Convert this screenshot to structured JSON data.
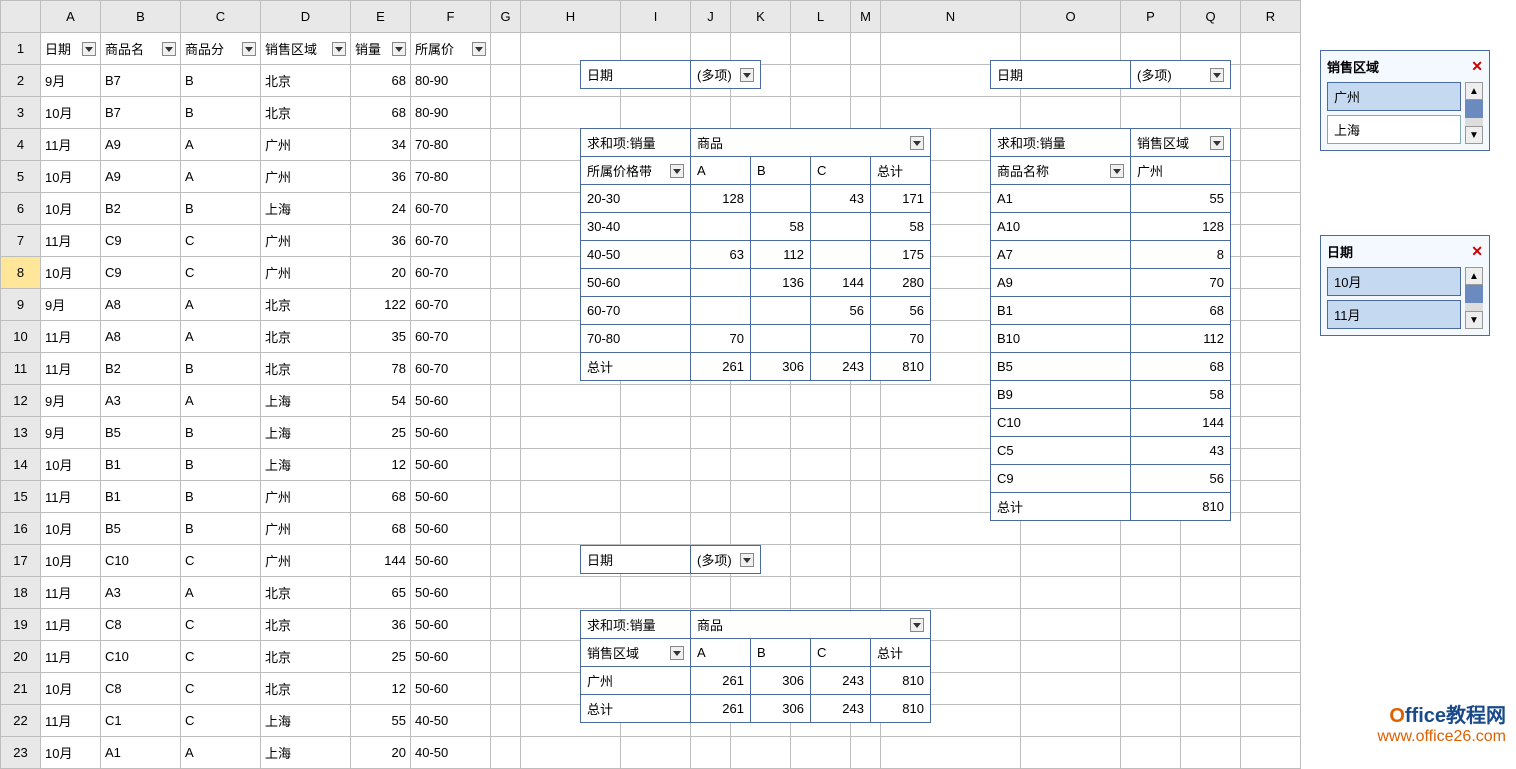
{
  "columns": [
    "",
    "A",
    "B",
    "C",
    "D",
    "E",
    "F",
    "G",
    "H",
    "I",
    "J",
    "K",
    "L",
    "M",
    "N",
    "O",
    "P",
    "Q",
    "R"
  ],
  "headers": [
    "日期",
    "商品名",
    "商品分",
    "销售区域",
    "销量",
    "所属价"
  ],
  "rows": [
    {
      "r": 2,
      "d": [
        "9月",
        "B7",
        "B",
        "北京",
        "68",
        "80-90"
      ]
    },
    {
      "r": 3,
      "d": [
        "10月",
        "B7",
        "B",
        "北京",
        "68",
        "80-90"
      ]
    },
    {
      "r": 4,
      "d": [
        "11月",
        "A9",
        "A",
        "广州",
        "34",
        "70-80"
      ]
    },
    {
      "r": 5,
      "d": [
        "10月",
        "A9",
        "A",
        "广州",
        "36",
        "70-80"
      ]
    },
    {
      "r": 6,
      "d": [
        "10月",
        "B2",
        "B",
        "上海",
        "24",
        "60-70"
      ]
    },
    {
      "r": 7,
      "d": [
        "11月",
        "C9",
        "C",
        "广州",
        "36",
        "60-70"
      ]
    },
    {
      "r": 8,
      "d": [
        "10月",
        "C9",
        "C",
        "广州",
        "20",
        "60-70"
      ],
      "sel": true
    },
    {
      "r": 9,
      "d": [
        "9月",
        "A8",
        "A",
        "北京",
        "122",
        "60-70"
      ]
    },
    {
      "r": 10,
      "d": [
        "11月",
        "A8",
        "A",
        "北京",
        "35",
        "60-70"
      ]
    },
    {
      "r": 11,
      "d": [
        "11月",
        "B2",
        "B",
        "北京",
        "78",
        "60-70"
      ]
    },
    {
      "r": 12,
      "d": [
        "9月",
        "A3",
        "A",
        "上海",
        "54",
        "50-60"
      ]
    },
    {
      "r": 13,
      "d": [
        "9月",
        "B5",
        "B",
        "上海",
        "25",
        "50-60"
      ]
    },
    {
      "r": 14,
      "d": [
        "10月",
        "B1",
        "B",
        "上海",
        "12",
        "50-60"
      ]
    },
    {
      "r": 15,
      "d": [
        "11月",
        "B1",
        "B",
        "广州",
        "68",
        "50-60"
      ]
    },
    {
      "r": 16,
      "d": [
        "10月",
        "B5",
        "B",
        "广州",
        "68",
        "50-60"
      ]
    },
    {
      "r": 17,
      "d": [
        "10月",
        "C10",
        "C",
        "广州",
        "144",
        "50-60"
      ]
    },
    {
      "r": 18,
      "d": [
        "11月",
        "A3",
        "A",
        "北京",
        "65",
        "50-60"
      ]
    },
    {
      "r": 19,
      "d": [
        "11月",
        "C8",
        "C",
        "北京",
        "36",
        "50-60"
      ]
    },
    {
      "r": 20,
      "d": [
        "11月",
        "C10",
        "C",
        "北京",
        "25",
        "50-60"
      ]
    },
    {
      "r": 21,
      "d": [
        "10月",
        "C8",
        "C",
        "北京",
        "12",
        "50-60"
      ]
    },
    {
      "r": 22,
      "d": [
        "11月",
        "C1",
        "C",
        "上海",
        "55",
        "40-50"
      ]
    },
    {
      "r": 23,
      "d": [
        "10月",
        "A1",
        "A",
        "上海",
        "20",
        "40-50"
      ]
    }
  ],
  "pivotFilter1": {
    "label": "日期",
    "value": "(多项)"
  },
  "pivot1": {
    "sumLabel": "求和项:销量",
    "colLabel": "商品",
    "rowLabel": "所属价格带",
    "cols": [
      "A",
      "B",
      "C",
      "总计"
    ],
    "data": [
      {
        "k": "20-30",
        "v": [
          "128",
          "",
          "43",
          "171"
        ]
      },
      {
        "k": "30-40",
        "v": [
          "",
          "58",
          "",
          "58"
        ]
      },
      {
        "k": "40-50",
        "v": [
          "63",
          "112",
          "",
          "175"
        ]
      },
      {
        "k": "50-60",
        "v": [
          "",
          "136",
          "144",
          "280"
        ]
      },
      {
        "k": "60-70",
        "v": [
          "",
          "",
          "56",
          "56"
        ]
      },
      {
        "k": "70-80",
        "v": [
          "70",
          "",
          "",
          "70"
        ]
      },
      {
        "k": "总计",
        "v": [
          "261",
          "306",
          "243",
          "810"
        ]
      }
    ]
  },
  "pivotFilter2": {
    "label": "日期",
    "value": "(多项)"
  },
  "pivot2": {
    "sumLabel": "求和项:销量",
    "colLabel": "销售区域",
    "rowLabel": "商品名称",
    "cols": [
      "广州"
    ],
    "data": [
      {
        "k": "A1",
        "v": [
          "55"
        ]
      },
      {
        "k": "A10",
        "v": [
          "128"
        ]
      },
      {
        "k": "A7",
        "v": [
          "8"
        ]
      },
      {
        "k": "A9",
        "v": [
          "70"
        ]
      },
      {
        "k": "B1",
        "v": [
          "68"
        ]
      },
      {
        "k": "B10",
        "v": [
          "112"
        ]
      },
      {
        "k": "B5",
        "v": [
          "68"
        ]
      },
      {
        "k": "B9",
        "v": [
          "58"
        ]
      },
      {
        "k": "C10",
        "v": [
          "144"
        ]
      },
      {
        "k": "C5",
        "v": [
          "43"
        ]
      },
      {
        "k": "C9",
        "v": [
          "56"
        ]
      },
      {
        "k": "总计",
        "v": [
          "810"
        ]
      }
    ]
  },
  "pivotFilter3": {
    "label": "日期",
    "value": "(多项)"
  },
  "pivot3": {
    "sumLabel": "求和项:销量",
    "colLabel": "商品",
    "rowLabel": "销售区域",
    "cols": [
      "A",
      "B",
      "C",
      "总计"
    ],
    "data": [
      {
        "k": "广州",
        "v": [
          "261",
          "306",
          "243",
          "810"
        ]
      },
      {
        "k": "总计",
        "v": [
          "261",
          "306",
          "243",
          "810"
        ]
      }
    ]
  },
  "slicer1": {
    "title": "销售区域",
    "items": [
      {
        "t": "广州",
        "sel": true
      },
      {
        "t": "上海",
        "sel": false
      }
    ]
  },
  "slicer2": {
    "title": "日期",
    "items": [
      {
        "t": "10月",
        "sel": true
      },
      {
        "t": "11月",
        "sel": true
      }
    ]
  },
  "watermark": {
    "line1a": "O",
    "line1b": "ffice教程网",
    "line2": "www.office26.com"
  }
}
